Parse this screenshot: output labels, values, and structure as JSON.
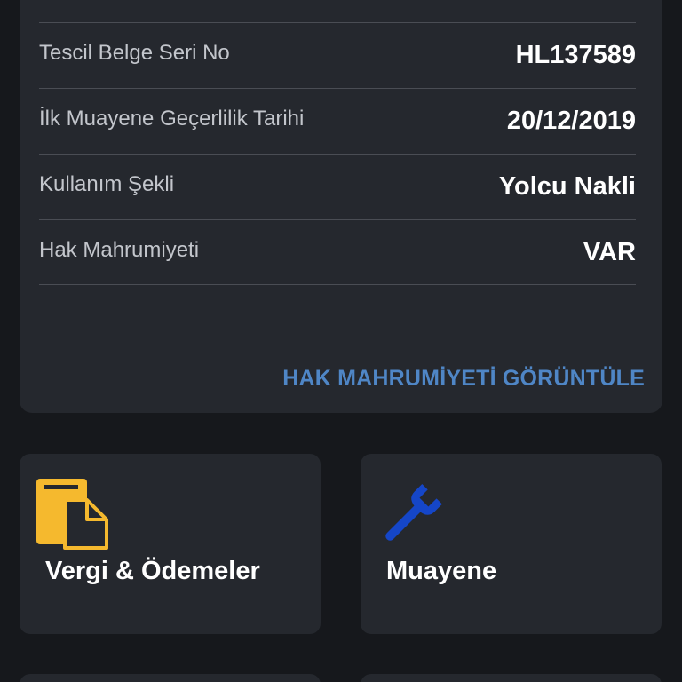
{
  "vehicle_info": {
    "rows": [
      {
        "label": "Tescil Belge Seri No",
        "value": "HL137589"
      },
      {
        "label": "İlk Muayene Geçerlilik Tarihi",
        "value": "20/12/2019"
      },
      {
        "label": "Kullanım Şekli",
        "value": "Yolcu Nakli"
      },
      {
        "label": "Hak Mahrumiyeti",
        "value": "VAR"
      }
    ],
    "action_label": "HAK MAHRUMİYETİ GÖRÜNTÜLE"
  },
  "tiles": [
    {
      "label": "Vergi & Ödemeler",
      "icon": "documents-icon"
    },
    {
      "label": "Muayene",
      "icon": "wrench-icon"
    }
  ],
  "colors": {
    "background": "#16181c",
    "card": "#25282e",
    "accent_link": "#4f86c6",
    "documents_icon": "#f5b92e",
    "wrench_icon": "#1546c8"
  }
}
